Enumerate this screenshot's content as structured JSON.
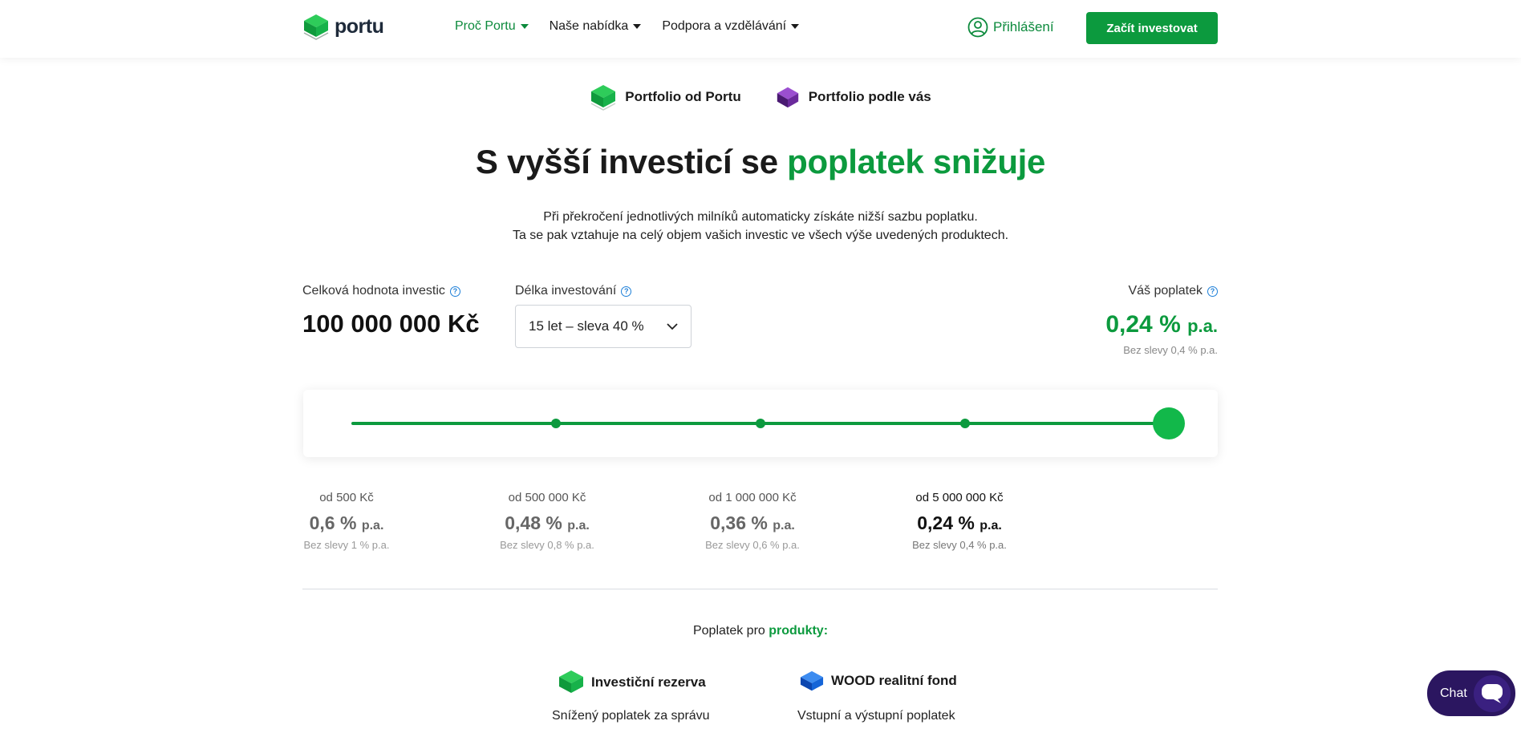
{
  "header": {
    "logo_text": "portu",
    "nav": [
      {
        "label": "Proč Portu"
      },
      {
        "label": "Naše nabídka"
      },
      {
        "label": "Podpora a vzdělávání"
      }
    ],
    "login_label": "Přihlášení",
    "cta_label": "Začít investovat"
  },
  "switch": {
    "items": [
      {
        "label": "Portfolio od Portu"
      },
      {
        "label": "Portfolio podle vás"
      }
    ]
  },
  "headline": {
    "part1": "S vyšší investicí se ",
    "part2": "poplatek snižuje"
  },
  "subtext": {
    "line1": "Při překročení jednotlivých milníků automaticky získáte nižší sazbu poplatku.",
    "line2": "Ta se pak vztahuje na celý objem vašich investic ve všech výše uvedených produktech."
  },
  "calculator": {
    "amount_label": "Celková hodnota investic",
    "amount_value": "100 000 000 Kč",
    "duration_label": "Délka investování",
    "duration_value": "15 let – sleva 40 %",
    "fee_label": "Váš poplatek",
    "fee_value": "0,24 %",
    "fee_unit": "p.a.",
    "fee_note": "Bez slevy 0,4 % p.a.",
    "slider_level": 1.0
  },
  "tiers": [
    {
      "from": "od 500 Kč",
      "fee": "0,6 %",
      "unit": "p.a.",
      "note": "Bez slevy 1 % p.a."
    },
    {
      "from": "od 500 000 Kč",
      "fee": "0,48 %",
      "unit": "p.a.",
      "note": "Bez slevy 0,8 % p.a."
    },
    {
      "from": "od 1 000 000 Kč",
      "fee": "0,36 %",
      "unit": "p.a.",
      "note": "Bez slevy 0,6 % p.a."
    },
    {
      "from": "od 5 000 000 Kč",
      "fee": "0,24 %",
      "unit": "p.a.",
      "note": "Bez slevy 0,4 % p.a."
    }
  ],
  "products": {
    "title_part1": "Poplatek pro ",
    "title_part2": "produkty:",
    "items": [
      {
        "name": "Investiční rezerva",
        "sub": "Snížený poplatek za správu"
      },
      {
        "name": "WOOD realitní fond",
        "sub": "Vstupní a výstupní poplatek"
      }
    ]
  },
  "chat": {
    "label": "Chat"
  },
  "colors": {
    "accent": "#0c9a3e",
    "purple": "#6b2a9c",
    "blue": "#1565d8",
    "chat": "#2b1660"
  }
}
